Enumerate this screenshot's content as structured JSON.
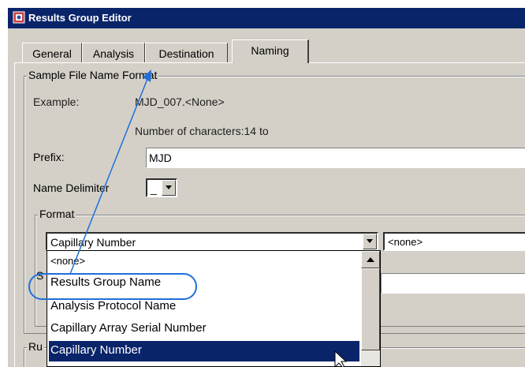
{
  "window": {
    "title": "Results Group Editor"
  },
  "tabs": [
    {
      "label": "General"
    },
    {
      "label": "Analysis"
    },
    {
      "label": "Destination"
    },
    {
      "label": "Naming"
    }
  ],
  "sample_format": {
    "legend": "Sample File Name Format",
    "example_label": "Example:",
    "example_value": "MJD_007.<None>",
    "char_count": "Number of characters:14 to",
    "prefix_label": "Prefix:",
    "prefix_value": "MJD",
    "delimiter_label": "Name Delimiter",
    "delimiter_value": "_",
    "format_legend": "Format",
    "format_selected": "Capillary Number",
    "second_selected": "<none>",
    "partial_label": "S",
    "bottom_legend_partial": "Ru"
  },
  "dropdown": {
    "items": [
      "<none>",
      "Results Group Name",
      "Analysis Protocol Name",
      "Capillary Array Serial Number",
      "Capillary Number"
    ],
    "selected_index": 4,
    "highlighted_index": 1
  },
  "colors": {
    "selection": "#0a246a",
    "annotation": "#1e6fd9",
    "window_bg": "#d4d0c8"
  }
}
